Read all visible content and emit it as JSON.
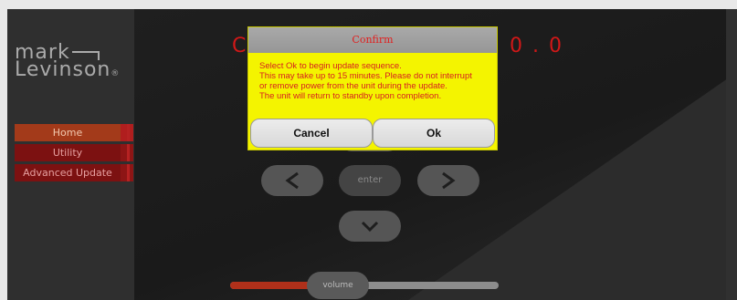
{
  "logo": {
    "line1": "mark",
    "line2": "Levinson",
    "reg": "®"
  },
  "sidebar": {
    "items": [
      {
        "label": "Home",
        "active": true
      },
      {
        "label": "Utility",
        "active": false
      },
      {
        "label": "Advanced Update",
        "active": false
      }
    ]
  },
  "display": {
    "left_text": "C",
    "right_text": "0 . 0"
  },
  "controls": {
    "up_icon": "chevron-up-icon",
    "left_icon": "chevron-left-icon",
    "right_icon": "chevron-right-icon",
    "down_icon": "chevron-down-icon",
    "enter_label": "enter"
  },
  "volume": {
    "label": "volume",
    "level_fraction": 0.31
  },
  "dialog": {
    "title": "Confirm",
    "lines": [
      "Select Ok to begin update sequence.",
      "This may take up to 15 minutes. Please do not interrupt",
      "or remove power from the unit during the update.",
      "The unit will return to standby upon completion."
    ],
    "cancel_label": "Cancel",
    "ok_label": "Ok"
  },
  "colors": {
    "accent_red": "#d01818",
    "dialog_bg": "#f4f400",
    "nav_bg": "#7c1111"
  }
}
